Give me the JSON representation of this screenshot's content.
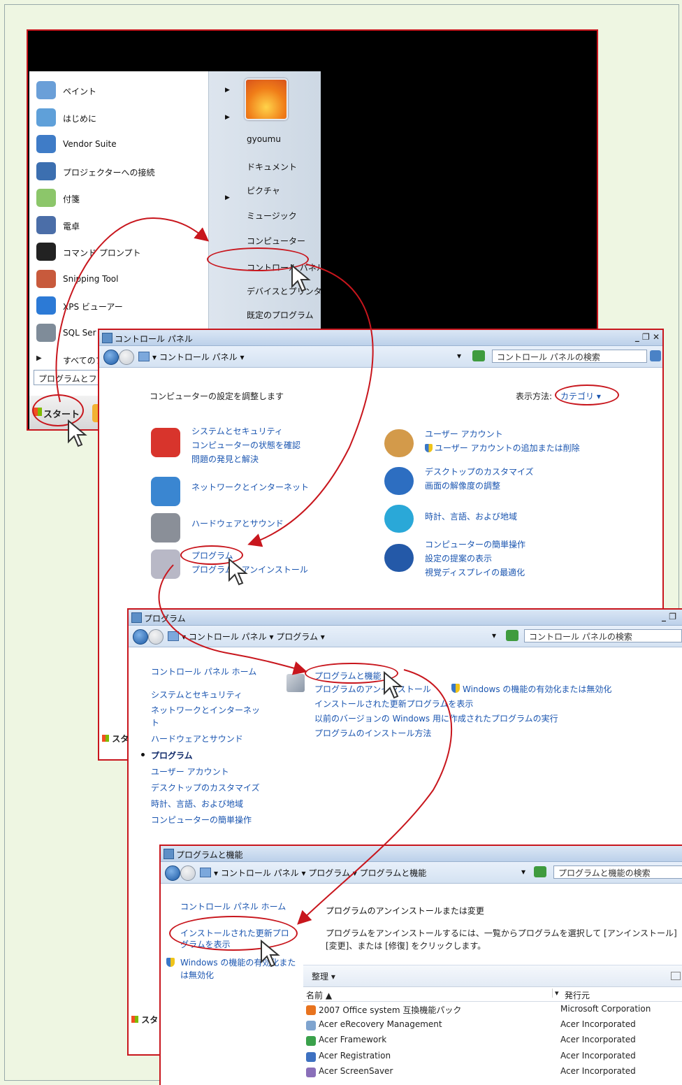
{
  "start_menu": {
    "left_items": [
      {
        "label": "ペイント",
        "has_arrow": true,
        "icon": "paint-icon"
      },
      {
        "label": "はじめに",
        "has_arrow": true,
        "icon": "getting-started-icon"
      },
      {
        "label": "Vendor Suite",
        "has_arrow": false,
        "icon": "vendor-suite-icon"
      },
      {
        "label": "プロジェクターへの接続",
        "has_arrow": false,
        "icon": "projector-icon"
      },
      {
        "label": "付箋",
        "has_arrow": true,
        "icon": "sticky-notes-icon"
      },
      {
        "label": "電卓",
        "has_arrow": false,
        "icon": "calculator-icon"
      },
      {
        "label": "コマンド プロンプト",
        "has_arrow": false,
        "icon": "command-prompt-icon"
      },
      {
        "label": "Snipping Tool",
        "has_arrow": false,
        "icon": "snipping-tool-icon"
      },
      {
        "label": "XPS ビューアー",
        "has_arrow": false,
        "icon": "xps-viewer-icon"
      },
      {
        "label": "SQL Ser",
        "has_arrow": false,
        "icon": "sql-server-icon"
      }
    ],
    "all_programs": "すべてのプ",
    "search_placeholder": "プログラムとフ",
    "right_items": [
      "gyoumu",
      "ドキュメント",
      "ピクチャ",
      "ミュージック",
      "コンピューター",
      "コントロール パネル",
      "デバイスとプリンタ",
      "既定のプログラム"
    ],
    "start_button": "スタート"
  },
  "control_panel": {
    "title": "コントロール パネル",
    "breadcrumb": "▾ コントロール パネル ▾",
    "search_placeholder": "コントロール パネルの検索",
    "heading": "コンピューターの設定を調整します",
    "view_by_label": "表示方法:",
    "view_by_value": "カテゴリ ▾",
    "left_categories": [
      {
        "title": "システムとセキュリティ",
        "links": [
          "コンピューターの状態を確認",
          "問題の発見と解決"
        ],
        "icon": "shield-icon"
      },
      {
        "title": "ネットワークとインターネット",
        "links": [],
        "icon": "network-globe-icon"
      },
      {
        "title": "ハードウェアとサウンド",
        "links": [],
        "icon": "printer-icon"
      },
      {
        "title": "プログラム",
        "links": [
          "プログラムのアンインストール"
        ],
        "icon": "programs-box-icon"
      }
    ],
    "right_categories": [
      {
        "title": "ユーザー アカウント",
        "links": [
          "ユーザー アカウントの追加または削除"
        ],
        "icon": "users-icon"
      },
      {
        "title": "デスクトップのカスタマイズ",
        "links": [
          "画面の解像度の調整"
        ],
        "icon": "desktop-icon"
      },
      {
        "title": "時計、言語、および地域",
        "links": [],
        "icon": "clock-globe-icon"
      },
      {
        "title": "コンピューターの簡単操作",
        "links": [
          "設定の提案の表示",
          "視覚ディスプレイの最適化"
        ],
        "icon": "ease-of-access-icon"
      }
    ]
  },
  "programs": {
    "title": "プログラム",
    "breadcrumb": "▾ コントロール パネル ▾ プログラム ▾",
    "search_placeholder": "コントロール パネルの検索",
    "nav": [
      "コントロール パネル ホーム",
      "システムとセキュリティ",
      "ネットワークとインターネッ",
      "ト",
      "ハードウェアとサウンド",
      "プログラム",
      "ユーザー アカウント",
      "デスクトップのカスタマイズ",
      "時計、言語、および地域",
      "コンピューターの簡単操作"
    ],
    "current_nav": "プログラム",
    "section_title": "プログラムと機能",
    "links_row1": [
      "プログラムのアンインストール",
      "Windows の機能の有効化または無効化"
    ],
    "links": [
      "インストールされた更新プログラムを表示",
      "以前のバージョンの Windows 用に作成されたプログラムの実行",
      "プログラムのインストール方法"
    ]
  },
  "programs_features": {
    "title": "プログラムと機能",
    "breadcrumb": "▾ コントロール パネル ▾ プログラム ▾ プログラムと機能",
    "search_placeholder": "プログラムと機能の検索",
    "nav": [
      "コントロール パネル ホーム",
      "インストールされた更新プロ",
      "グラムを表示",
      "Windows の機能の有効化また",
      "は無効化"
    ],
    "heading": "プログラムのアンインストールまたは変更",
    "description_line1": "プログラムをアンインストールするには、一覧からプログラムを選択して [アンインストール]",
    "description_line2": "[変更]、または [修復] をクリックします。",
    "organize": "整理 ▾",
    "columns": [
      "名前 ▲",
      "発行元"
    ],
    "rows": [
      {
        "name": "2007 Office system 互換機能パック",
        "publisher": "Microsoft Corporation"
      },
      {
        "name": "Acer eRecovery Management",
        "publisher": "Acer Incorporated"
      },
      {
        "name": "Acer Framework",
        "publisher": "Acer Incorporated"
      },
      {
        "name": "Acer Registration",
        "publisher": "Acer Incorporated"
      },
      {
        "name": "Acer ScreenSaver",
        "publisher": "Acer Incorporated"
      }
    ]
  },
  "taskbar_start_fragments": [
    "スタ",
    "スタ",
    "スタ"
  ],
  "colors": {
    "highlight": "#c8161d",
    "link": "#1a55b0",
    "background": "#eef6e2"
  }
}
